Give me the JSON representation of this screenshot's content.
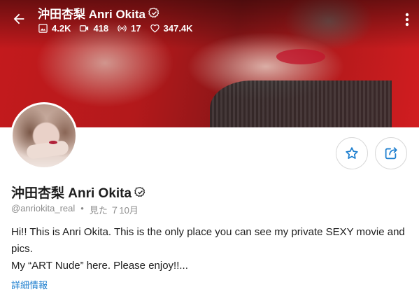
{
  "header": {
    "title": "沖田杏梨 Anri Okita",
    "stats": {
      "photos": "4.2K",
      "videos": "418",
      "streams": "17",
      "likes": "347.4K"
    }
  },
  "profile": {
    "name": "沖田杏梨 Anri Okita",
    "handle": "@anriokita_real",
    "separator": "•",
    "last_seen": "見た ７10月",
    "bio_lines": [
      "Hi!! This is Anri Okita. This is the only place you can see my private SEXY movie and pics.",
      "My “ART Nude” here. Please enjoy!!..."
    ],
    "details_link": "詳細情報"
  },
  "icons": {
    "back": "back-arrow-icon",
    "verified": "verified-badge-icon",
    "photos": "image-icon",
    "videos": "video-icon",
    "streams": "broadcast-icon",
    "likes": "heart-icon",
    "more": "more-vertical-icon",
    "favorite": "star-icon",
    "share": "share-icon"
  },
  "colors": {
    "accent": "#1e7fcf",
    "muted_text": "#8c8c8c",
    "cover_red": "#c41a1d"
  }
}
